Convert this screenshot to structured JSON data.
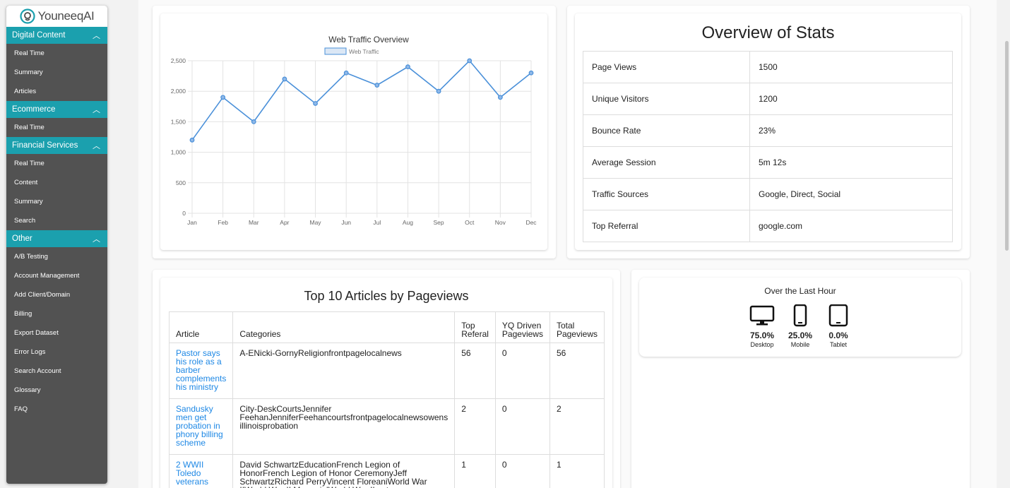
{
  "app": {
    "logo_text": "YouneeqAI"
  },
  "sidebar": {
    "sections": [
      {
        "title": "Digital Content",
        "items": [
          "Real Time",
          "Summary",
          "Articles"
        ]
      },
      {
        "title": "Ecommerce",
        "items": [
          "Real Time"
        ]
      },
      {
        "title": "Financial Services",
        "items": [
          "Real Time",
          "Content",
          "Summary",
          "Search"
        ]
      },
      {
        "title": "Other",
        "items": [
          "A/B Testing",
          "Account Management",
          "Add Client/Domain",
          "Billing",
          "Export Dataset",
          "Error Logs",
          "Search Account",
          "Glossary",
          "FAQ"
        ]
      }
    ]
  },
  "chart_data": {
    "type": "line",
    "title": "Web Traffic Overview",
    "categories": [
      "Jan",
      "Feb",
      "Mar",
      "Apr",
      "May",
      "Jun",
      "Jul",
      "Aug",
      "Sep",
      "Oct",
      "Nov",
      "Dec"
    ],
    "series": [
      {
        "name": "Web Traffic",
        "values": [
          1200,
          1900,
          1500,
          2200,
          1800,
          2300,
          2100,
          2400,
          2000,
          2500,
          1900,
          2300
        ]
      }
    ],
    "ylim": [
      0,
      2500
    ],
    "yticks": [
      "0",
      "500",
      "1,000",
      "1,500",
      "2,000",
      "2,500"
    ],
    "grid": true,
    "legend": "top",
    "color": "#4a90d9"
  },
  "stats": {
    "title": "Overview of Stats",
    "rows": [
      {
        "label": "Page Views",
        "value": "1500"
      },
      {
        "label": "Unique Visitors",
        "value": "1200"
      },
      {
        "label": "Bounce Rate",
        "value": "23%"
      },
      {
        "label": "Average Session",
        "value": "5m 12s"
      },
      {
        "label": "Traffic Sources",
        "value": "Google, Direct, Social"
      },
      {
        "label": "Top Referral",
        "value": "google.com"
      }
    ]
  },
  "articles": {
    "title": "Top 10 Articles by Pageviews",
    "headers": [
      "Article",
      "Categories",
      "Top Referal",
      "YQ Driven Pageviews",
      "Total Pageviews"
    ],
    "rows": [
      {
        "article": "Pastor says his role as a barber complements his ministry",
        "categories": "A-ENicki-GornyReligionfrontpagelocalnews",
        "referal": "56",
        "yq": "0",
        "total": "56"
      },
      {
        "article": "Sandusky men get probation in phony billing scheme",
        "categories": "City-DeskCourtsJennifer FeehanJenniferFeehancourtsfrontpagelocalnewsowens illinoisprobation",
        "referal": "2",
        "yq": "0",
        "total": "2"
      },
      {
        "article": "2 WWII Toledo veterans",
        "categories": "David SchwartzEducationFrench Legion of HonorFrench Legion of Honor CeremonyJeff SchwartzRichard PerryVincent FloreaniWorld War IIWorld War II MemorialWorld War II veterans",
        "referal": "1",
        "yq": "0",
        "total": "1"
      }
    ]
  },
  "devices": {
    "title": "Over the Last Hour",
    "items": [
      {
        "pct": "75.0%",
        "label": "Desktop",
        "icon": "desktop-icon"
      },
      {
        "pct": "25.0%",
        "label": "Mobile",
        "icon": "mobile-icon"
      },
      {
        "pct": "0.0%",
        "label": "Tablet",
        "icon": "tablet-icon"
      }
    ]
  }
}
